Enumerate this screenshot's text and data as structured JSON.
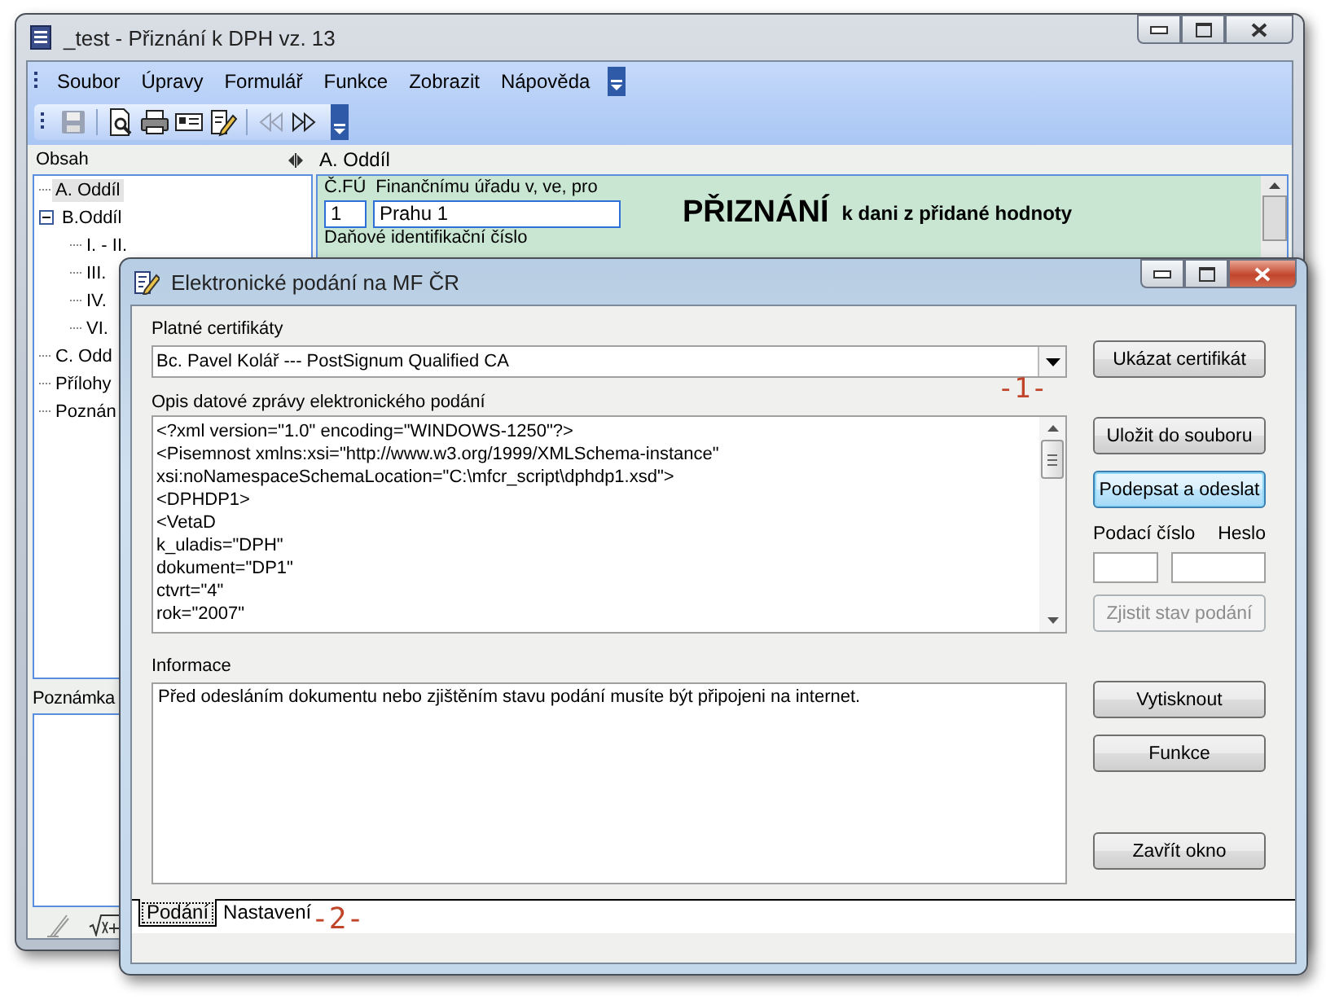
{
  "main_window": {
    "title": "_test - Přiznání k DPH vz. 13"
  },
  "menu": [
    "Soubor",
    "Úpravy",
    "Formulář",
    "Funkce",
    "Zobrazit",
    "Nápověda"
  ],
  "toolbar": [
    {
      "kind": "save",
      "disabled": true
    },
    {
      "kind": "preview",
      "disabled": false
    },
    {
      "kind": "print",
      "disabled": false
    },
    {
      "kind": "card",
      "disabled": false
    },
    {
      "kind": "edit",
      "disabled": false
    },
    {
      "kind": "previous",
      "disabled": true
    },
    {
      "kind": "next",
      "disabled": false
    }
  ],
  "sidebar": {
    "title": "Obsah",
    "tree": [
      {
        "label": "A. Oddíl",
        "selected": true
      },
      {
        "label": "B.Oddíl",
        "selected": false,
        "expanded": true,
        "children": [
          {
            "label": "I. - II.",
            "selected": false
          },
          {
            "label": "III.",
            "selected": false
          },
          {
            "label": "IV.",
            "selected": false
          },
          {
            "label": "VI.",
            "selected": false
          }
        ]
      },
      {
        "label": "C. Odd",
        "selected": false
      },
      {
        "label": "Přílohy",
        "selected": false
      },
      {
        "label": "Poznán",
        "selected": false
      }
    ]
  },
  "note": {
    "label": "Poznámka"
  },
  "form": {
    "section": "A. Oddíl",
    "office_code_label": "Č.FÚ",
    "office_label": "Finančnímu úřadu v, ve, pro",
    "office_code": "1",
    "office_name": "Prahu 1",
    "heading": "PŘIZNÁNÍ",
    "subheading": "k dani z přidané hodnoty",
    "tax_id_label": "Daňové identifikační číslo"
  },
  "dialog": {
    "title": "Elektronické podání na MF ČR",
    "cert_label": "Platné certifikáty",
    "cert_value": "Bc. Pavel Kolář --- PostSignum Qualified CA",
    "annotation_1": "-1-",
    "message_label": "Opis datové zprávy elektronického podání",
    "message_lines": [
      "<?xml version=\"1.0\" encoding=\"WINDOWS-1250\"?>",
      "<Pisemnost xmlns:xsi=\"http://www.w3.org/1999/XMLSchema-instance\"",
      "xsi:noNamespaceSchemaLocation=\"C:\\mfcr_script\\dphdp1.xsd\">",
      "<DPHDP1>",
      "<VetaD",
      "k_uladis=\"DPH\"",
      "dokument=\"DP1\"",
      "ctvrt=\"4\"",
      "rok=\"2007\""
    ],
    "info_label": "Informace",
    "info_text": "Před odesláním dokumentu nebo zjištěním stavu podání musíte být připojeni na internet.",
    "cert_button": {
      "label": "Ukázat certifikát",
      "focused": false,
      "disabled": false
    },
    "file_buttons": [
      {
        "label": "Uložit do souboru",
        "focused": false,
        "disabled": false
      },
      {
        "label": "Podepsat a odeslat",
        "focused": true,
        "disabled": false
      }
    ],
    "number_label": "Podací číslo",
    "password_label": "Heslo",
    "status_button": {
      "label": "Zjistit stav podání",
      "focused": false,
      "disabled": true
    },
    "print_buttons": [
      {
        "label": "Vytisknout",
        "focused": false,
        "disabled": false
      },
      {
        "label": "Funkce",
        "focused": false,
        "disabled": false
      }
    ],
    "close_button": {
      "label": "Zavřít okno",
      "focused": false,
      "disabled": false
    },
    "tabs": [
      {
        "label": "Podání",
        "selected": true
      },
      {
        "label": "Nastavení",
        "selected": false
      }
    ],
    "annotation_2": "-2-"
  }
}
